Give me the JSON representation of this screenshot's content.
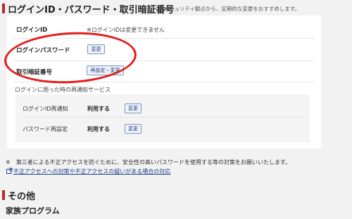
{
  "section": {
    "title": "ログインID・パスワード・取引暗証番号",
    "note": "※セキュリティ観点から、定期的な変更をおすすめします。"
  },
  "rows": {
    "login_id": {
      "label": "ログインID",
      "value": "※ログインIDは変更できません"
    },
    "login_password": {
      "label": "ログインパスワード",
      "button": "変更"
    },
    "trading_pin": {
      "label": "取引暗証番号",
      "button": "再設定・変更"
    }
  },
  "notification": {
    "heading": "ログインに困った時の再通知サービス",
    "items": [
      {
        "label": "ログインID再通知",
        "status": "利用する",
        "button": "変更"
      },
      {
        "label": "パスワード再設定",
        "status": "利用する",
        "button": "変更"
      }
    ]
  },
  "footnote": "※　第三者による不正アクセスを防ぐために、安全性の高いパスワードを使用する等の対策をお願いいたします。",
  "link": {
    "text": "不正アクセスへの対策や不正アクセスの疑いがある場合の対応",
    "icon": "external-link-icon"
  },
  "other": {
    "title": "その他",
    "family_program": "家族プログラム"
  },
  "colors": {
    "accent_bar": "#b42b2b",
    "annotation_circle": "#e41c1c",
    "button_border": "#7f95bd",
    "link": "#1d3f8a"
  }
}
